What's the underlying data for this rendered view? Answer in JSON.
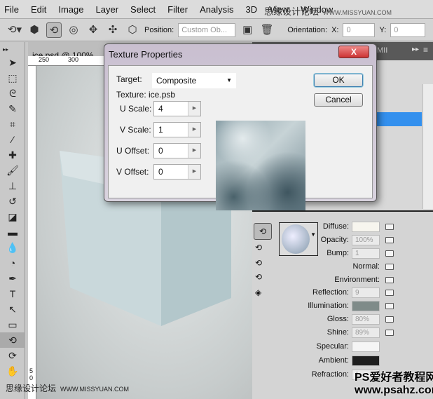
{
  "menu": [
    "File",
    "Edit",
    "Image",
    "Layer",
    "Select",
    "Filter",
    "Analysis",
    "3D",
    "View",
    "Window"
  ],
  "watermark_top": {
    "cn": "思缘设计论坛",
    "url": "WWW.MISSYUAN.COM"
  },
  "options": {
    "position_label": "Position:",
    "position_value": "Custom Ob...",
    "orientation_label": "Orientation:",
    "x_label": "X:",
    "x_value": "0",
    "y_label": "Y:",
    "y_value": "0"
  },
  "document": {
    "tab": "ice.psd @ 100% (Sh",
    "ruler": [
      "250",
      "300"
    ],
    "vruler": [
      "5",
      "0"
    ]
  },
  "right_panel": {
    "tab": "MII"
  },
  "dialog": {
    "title": "Texture Properties",
    "close": "X",
    "target_label": "Target:",
    "target_value": "Composite",
    "texture_label": "Texture: ice.psb",
    "fields": [
      {
        "label": "U Scale:",
        "value": "4"
      },
      {
        "label": "V Scale:",
        "value": "1"
      },
      {
        "label": "U Offset:",
        "value": "0"
      },
      {
        "label": "V Offset:",
        "value": "0"
      }
    ],
    "ok": "OK",
    "cancel": "Cancel"
  },
  "materials": {
    "rows": [
      {
        "label": "Diffuse:",
        "type": "color",
        "color": "#f7f5ee",
        "icon": "texture"
      },
      {
        "label": "Opacity:",
        "type": "value",
        "value": "100%",
        "icon": "folder"
      },
      {
        "label": "Bump:",
        "type": "value",
        "value": "1",
        "icon": "texture"
      },
      {
        "label": "Normal:",
        "type": "none",
        "icon": "folder"
      },
      {
        "label": "Environment:",
        "type": "none",
        "icon": "folder"
      },
      {
        "label": "Reflection:",
        "type": "value",
        "value": "9",
        "icon": "folder"
      },
      {
        "label": "Illumination:",
        "type": "color",
        "color": "#7f8b89",
        "icon": "folder"
      },
      {
        "label": "Gloss:",
        "type": "value",
        "value": "80%",
        "icon": "folder"
      },
      {
        "label": "Shine:",
        "type": "value",
        "value": "89%",
        "icon": "folder"
      },
      {
        "label": "Specular:",
        "type": "color",
        "color": "#f5f5f5"
      },
      {
        "label": "Ambient:",
        "type": "color",
        "color": "#1e1e1e"
      },
      {
        "label": "Refraction:",
        "type": "value",
        "value": "1"
      }
    ]
  },
  "watermark_bottom": {
    "line1": "PS爱好者教程网",
    "line2": "www.psahz.com",
    "cn": "思缘设计论坛",
    "url": "WWW.MISSYUAN.COM"
  }
}
